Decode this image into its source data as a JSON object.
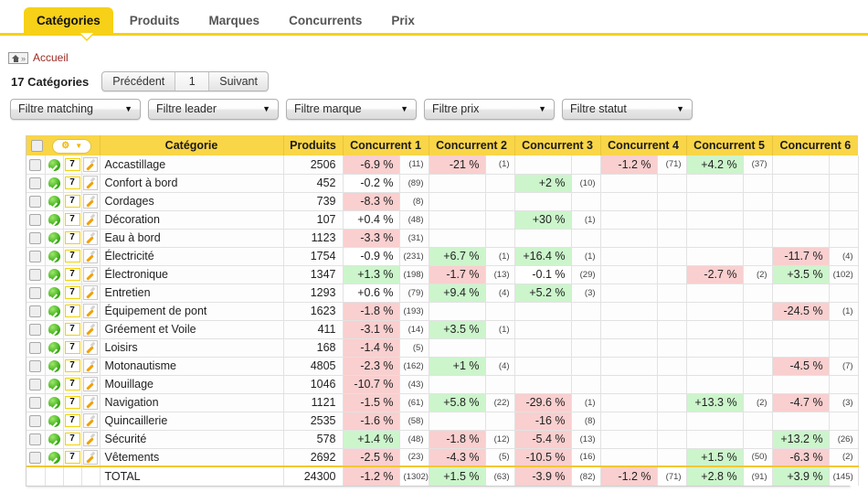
{
  "tabs": [
    {
      "label": "Catégories",
      "active": true
    },
    {
      "label": "Produits",
      "active": false
    },
    {
      "label": "Marques",
      "active": false
    },
    {
      "label": "Concurrents",
      "active": false
    },
    {
      "label": "Prix",
      "active": false
    }
  ],
  "breadcrumb": {
    "icon": "home-icon",
    "link": "Accueil"
  },
  "summary": {
    "count_label": "17 Catégories"
  },
  "pager": {
    "prev": "Précédent",
    "page": "1",
    "next": "Suivant"
  },
  "filters": [
    {
      "label": "Filtre matching"
    },
    {
      "label": "Filtre leader"
    },
    {
      "label": "Filtre marque"
    },
    {
      "label": "Filtre prix"
    },
    {
      "label": "Filtre statut"
    }
  ],
  "table": {
    "headers": {
      "select_all": "",
      "gear": "gear-icon",
      "category": "Catégorie",
      "products": "Produits",
      "competitors": [
        "Concurrent 1",
        "Concurrent 2",
        "Concurrent 3",
        "Concurrent 4",
        "Concurrent 5",
        "Concurrent 6"
      ]
    },
    "row_icons": {
      "status": "green-check-icon",
      "badge": "7",
      "edit": "pencil-icon"
    },
    "rows": [
      {
        "name": "Accastillage",
        "products": "2506",
        "cells": [
          {
            "pct": "-6.9 %",
            "cnt": "(11)",
            "tone": "neg"
          },
          {
            "pct": "-21 %",
            "cnt": "(1)",
            "tone": "neg"
          },
          {
            "pct": "",
            "cnt": "",
            "tone": "none"
          },
          {
            "pct": "-1.2 %",
            "cnt": "(71)",
            "tone": "neg"
          },
          {
            "pct": "+4.2 %",
            "cnt": "(37)",
            "tone": "pos"
          },
          {
            "pct": "",
            "cnt": "",
            "tone": "none"
          }
        ]
      },
      {
        "name": "Confort à bord",
        "products": "452",
        "cells": [
          {
            "pct": "-0.2 %",
            "cnt": "(89)",
            "tone": "neutral"
          },
          {
            "pct": "",
            "cnt": "",
            "tone": "none"
          },
          {
            "pct": "+2 %",
            "cnt": "(10)",
            "tone": "pos"
          },
          {
            "pct": "",
            "cnt": "",
            "tone": "none"
          },
          {
            "pct": "",
            "cnt": "",
            "tone": "none"
          },
          {
            "pct": "",
            "cnt": "",
            "tone": "none"
          }
        ]
      },
      {
        "name": "Cordages",
        "products": "739",
        "cells": [
          {
            "pct": "-8.3 %",
            "cnt": "(8)",
            "tone": "neg"
          },
          {
            "pct": "",
            "cnt": "",
            "tone": "none"
          },
          {
            "pct": "",
            "cnt": "",
            "tone": "none"
          },
          {
            "pct": "",
            "cnt": "",
            "tone": "none"
          },
          {
            "pct": "",
            "cnt": "",
            "tone": "none"
          },
          {
            "pct": "",
            "cnt": "",
            "tone": "none"
          }
        ]
      },
      {
        "name": "Décoration",
        "products": "107",
        "cells": [
          {
            "pct": "+0.4 %",
            "cnt": "(48)",
            "tone": "neutral"
          },
          {
            "pct": "",
            "cnt": "",
            "tone": "none"
          },
          {
            "pct": "+30 %",
            "cnt": "(1)",
            "tone": "pos"
          },
          {
            "pct": "",
            "cnt": "",
            "tone": "none"
          },
          {
            "pct": "",
            "cnt": "",
            "tone": "none"
          },
          {
            "pct": "",
            "cnt": "",
            "tone": "none"
          }
        ]
      },
      {
        "name": "Eau à bord",
        "products": "1123",
        "cells": [
          {
            "pct": "-3.3 %",
            "cnt": "(31)",
            "tone": "neg"
          },
          {
            "pct": "",
            "cnt": "",
            "tone": "none"
          },
          {
            "pct": "",
            "cnt": "",
            "tone": "none"
          },
          {
            "pct": "",
            "cnt": "",
            "tone": "none"
          },
          {
            "pct": "",
            "cnt": "",
            "tone": "none"
          },
          {
            "pct": "",
            "cnt": "",
            "tone": "none"
          }
        ]
      },
      {
        "name": "Électricité",
        "products": "1754",
        "cells": [
          {
            "pct": "-0.9 %",
            "cnt": "(231)",
            "tone": "neutral"
          },
          {
            "pct": "+6.7 %",
            "cnt": "(1)",
            "tone": "pos"
          },
          {
            "pct": "+16.4 %",
            "cnt": "(1)",
            "tone": "pos"
          },
          {
            "pct": "",
            "cnt": "",
            "tone": "none"
          },
          {
            "pct": "",
            "cnt": "",
            "tone": "none"
          },
          {
            "pct": "-11.7 %",
            "cnt": "(4)",
            "tone": "neg"
          }
        ]
      },
      {
        "name": "Électronique",
        "products": "1347",
        "cells": [
          {
            "pct": "+1.3 %",
            "cnt": "(198)",
            "tone": "pos"
          },
          {
            "pct": "-1.7 %",
            "cnt": "(13)",
            "tone": "neg"
          },
          {
            "pct": "-0.1 %",
            "cnt": "(29)",
            "tone": "neutral"
          },
          {
            "pct": "",
            "cnt": "",
            "tone": "none"
          },
          {
            "pct": "-2.7 %",
            "cnt": "(2)",
            "tone": "neg"
          },
          {
            "pct": "+3.5 %",
            "cnt": "(102)",
            "tone": "pos"
          }
        ]
      },
      {
        "name": "Entretien",
        "products": "1293",
        "cells": [
          {
            "pct": "+0.6 %",
            "cnt": "(79)",
            "tone": "neutral"
          },
          {
            "pct": "+9.4 %",
            "cnt": "(4)",
            "tone": "pos"
          },
          {
            "pct": "+5.2 %",
            "cnt": "(3)",
            "tone": "pos"
          },
          {
            "pct": "",
            "cnt": "",
            "tone": "none"
          },
          {
            "pct": "",
            "cnt": "",
            "tone": "none"
          },
          {
            "pct": "",
            "cnt": "",
            "tone": "none"
          }
        ]
      },
      {
        "name": "Équipement de pont",
        "products": "1623",
        "cells": [
          {
            "pct": "-1.8 %",
            "cnt": "(193)",
            "tone": "neg"
          },
          {
            "pct": "",
            "cnt": "",
            "tone": "none"
          },
          {
            "pct": "",
            "cnt": "",
            "tone": "none"
          },
          {
            "pct": "",
            "cnt": "",
            "tone": "none"
          },
          {
            "pct": "",
            "cnt": "",
            "tone": "none"
          },
          {
            "pct": "-24.5 %",
            "cnt": "(1)",
            "tone": "neg"
          }
        ]
      },
      {
        "name": "Gréement et Voile",
        "products": "411",
        "cells": [
          {
            "pct": "-3.1 %",
            "cnt": "(14)",
            "tone": "neg"
          },
          {
            "pct": "+3.5 %",
            "cnt": "(1)",
            "tone": "pos"
          },
          {
            "pct": "",
            "cnt": "",
            "tone": "none"
          },
          {
            "pct": "",
            "cnt": "",
            "tone": "none"
          },
          {
            "pct": "",
            "cnt": "",
            "tone": "none"
          },
          {
            "pct": "",
            "cnt": "",
            "tone": "none"
          }
        ]
      },
      {
        "name": "Loisirs",
        "products": "168",
        "cells": [
          {
            "pct": "-1.4 %",
            "cnt": "(5)",
            "tone": "neg"
          },
          {
            "pct": "",
            "cnt": "",
            "tone": "none"
          },
          {
            "pct": "",
            "cnt": "",
            "tone": "none"
          },
          {
            "pct": "",
            "cnt": "",
            "tone": "none"
          },
          {
            "pct": "",
            "cnt": "",
            "tone": "none"
          },
          {
            "pct": "",
            "cnt": "",
            "tone": "none"
          }
        ]
      },
      {
        "name": "Motonautisme",
        "products": "4805",
        "cells": [
          {
            "pct": "-2.3 %",
            "cnt": "(162)",
            "tone": "neg"
          },
          {
            "pct": "+1 %",
            "cnt": "(4)",
            "tone": "pos"
          },
          {
            "pct": "",
            "cnt": "",
            "tone": "none"
          },
          {
            "pct": "",
            "cnt": "",
            "tone": "none"
          },
          {
            "pct": "",
            "cnt": "",
            "tone": "none"
          },
          {
            "pct": "-4.5 %",
            "cnt": "(7)",
            "tone": "neg"
          }
        ]
      },
      {
        "name": "Mouillage",
        "products": "1046",
        "cells": [
          {
            "pct": "-10.7 %",
            "cnt": "(43)",
            "tone": "neg"
          },
          {
            "pct": "",
            "cnt": "",
            "tone": "none"
          },
          {
            "pct": "",
            "cnt": "",
            "tone": "none"
          },
          {
            "pct": "",
            "cnt": "",
            "tone": "none"
          },
          {
            "pct": "",
            "cnt": "",
            "tone": "none"
          },
          {
            "pct": "",
            "cnt": "",
            "tone": "none"
          }
        ]
      },
      {
        "name": "Navigation",
        "products": "1121",
        "cells": [
          {
            "pct": "-1.5 %",
            "cnt": "(61)",
            "tone": "neg"
          },
          {
            "pct": "+5.8 %",
            "cnt": "(22)",
            "tone": "pos"
          },
          {
            "pct": "-29.6 %",
            "cnt": "(1)",
            "tone": "neg"
          },
          {
            "pct": "",
            "cnt": "",
            "tone": "none"
          },
          {
            "pct": "+13.3 %",
            "cnt": "(2)",
            "tone": "pos"
          },
          {
            "pct": "-4.7 %",
            "cnt": "(3)",
            "tone": "neg"
          }
        ]
      },
      {
        "name": "Quincaillerie",
        "products": "2535",
        "cells": [
          {
            "pct": "-1.6 %",
            "cnt": "(58)",
            "tone": "neg"
          },
          {
            "pct": "",
            "cnt": "",
            "tone": "none"
          },
          {
            "pct": "-16 %",
            "cnt": "(8)",
            "tone": "neg"
          },
          {
            "pct": "",
            "cnt": "",
            "tone": "none"
          },
          {
            "pct": "",
            "cnt": "",
            "tone": "none"
          },
          {
            "pct": "",
            "cnt": "",
            "tone": "none"
          }
        ]
      },
      {
        "name": "Sécurité",
        "products": "578",
        "cells": [
          {
            "pct": "+1.4 %",
            "cnt": "(48)",
            "tone": "pos"
          },
          {
            "pct": "-1.8 %",
            "cnt": "(12)",
            "tone": "neg"
          },
          {
            "pct": "-5.4 %",
            "cnt": "(13)",
            "tone": "neg"
          },
          {
            "pct": "",
            "cnt": "",
            "tone": "none"
          },
          {
            "pct": "",
            "cnt": "",
            "tone": "none"
          },
          {
            "pct": "+13.2 %",
            "cnt": "(26)",
            "tone": "pos"
          }
        ]
      },
      {
        "name": "Vêtements",
        "products": "2692",
        "cells": [
          {
            "pct": "-2.5 %",
            "cnt": "(23)",
            "tone": "neg"
          },
          {
            "pct": "-4.3 %",
            "cnt": "(5)",
            "tone": "neg"
          },
          {
            "pct": "-10.5 %",
            "cnt": "(16)",
            "tone": "neg"
          },
          {
            "pct": "",
            "cnt": "",
            "tone": "none"
          },
          {
            "pct": "+1.5 %",
            "cnt": "(50)",
            "tone": "pos"
          },
          {
            "pct": "-6.3 %",
            "cnt": "(2)",
            "tone": "neg"
          }
        ]
      }
    ],
    "total": {
      "name": "TOTAL",
      "products": "24300",
      "cells": [
        {
          "pct": "-1.2 %",
          "cnt": "(1302)",
          "tone": "neg"
        },
        {
          "pct": "+1.5 %",
          "cnt": "(63)",
          "tone": "pos"
        },
        {
          "pct": "-3.9 %",
          "cnt": "(82)",
          "tone": "neg"
        },
        {
          "pct": "-1.2 %",
          "cnt": "(71)",
          "tone": "neg"
        },
        {
          "pct": "+2.8 %",
          "cnt": "(91)",
          "tone": "pos"
        },
        {
          "pct": "+3.9 %",
          "cnt": "(145)",
          "tone": "pos"
        }
      ]
    }
  },
  "colors": {
    "accent_yellow": "#f7d117",
    "header_yellow": "#f9d548",
    "positive_green": "#ccf5cc",
    "negative_red": "#f9cfcf",
    "link_red": "#9c2a22"
  }
}
